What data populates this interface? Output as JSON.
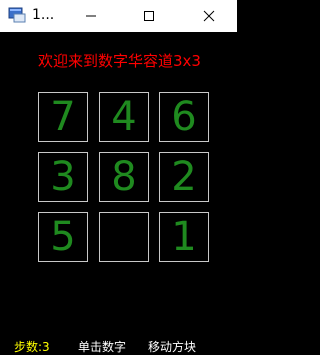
{
  "window": {
    "title": "1..."
  },
  "icons": {
    "app": "app-window-icon",
    "minimize": "minimize-icon",
    "maximize": "maximize-icon",
    "close": "close-icon"
  },
  "colors": {
    "background": "#000000",
    "heading": "#ff0000",
    "tile_number": "#1f8a1f",
    "tile_border": "#c8c8c8",
    "steps": "#ffff00",
    "hints": "#ffffff"
  },
  "game": {
    "heading": "欢迎来到数字华容道3x3",
    "grid": [
      [
        "7",
        "4",
        "6"
      ],
      [
        "3",
        "8",
        "2"
      ],
      [
        "5",
        "",
        "1"
      ]
    ]
  },
  "status": {
    "steps": "步数:3",
    "hint_click": "单击数字",
    "hint_move": "移动方块"
  }
}
